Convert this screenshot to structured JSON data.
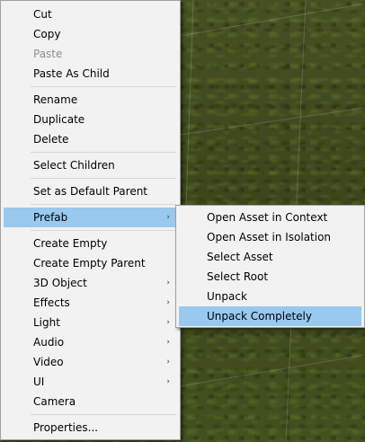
{
  "context_menu": {
    "items": [
      {
        "label": "Cut"
      },
      {
        "label": "Copy"
      },
      {
        "label": "Paste",
        "disabled": true
      },
      {
        "label": "Paste As Child"
      },
      {
        "label": "Rename"
      },
      {
        "label": "Duplicate"
      },
      {
        "label": "Delete"
      },
      {
        "label": "Select Children"
      },
      {
        "label": "Set as Default Parent"
      },
      {
        "label": "Prefab",
        "submenu": true,
        "highlighted": true
      },
      {
        "label": "Create Empty"
      },
      {
        "label": "Create Empty Parent"
      },
      {
        "label": "3D Object",
        "submenu": true
      },
      {
        "label": "Effects",
        "submenu": true
      },
      {
        "label": "Light",
        "submenu": true
      },
      {
        "label": "Audio",
        "submenu": true
      },
      {
        "label": "Video",
        "submenu": true
      },
      {
        "label": "UI",
        "submenu": true
      },
      {
        "label": "Camera"
      },
      {
        "label": "Properties..."
      }
    ],
    "submenu_arrow": "›"
  },
  "prefab_submenu": {
    "items": [
      {
        "label": "Open Asset in Context"
      },
      {
        "label": "Open Asset in Isolation"
      },
      {
        "label": "Select Asset"
      },
      {
        "label": "Select Root"
      },
      {
        "label": "Unpack"
      },
      {
        "label": "Unpack Completely",
        "highlighted": true
      }
    ]
  },
  "colors": {
    "menu_background": "#f2f2f2",
    "highlight": "#99c9ef",
    "disabled_text": "#8d8d8d",
    "scene_grass": "#3f4a1d"
  }
}
